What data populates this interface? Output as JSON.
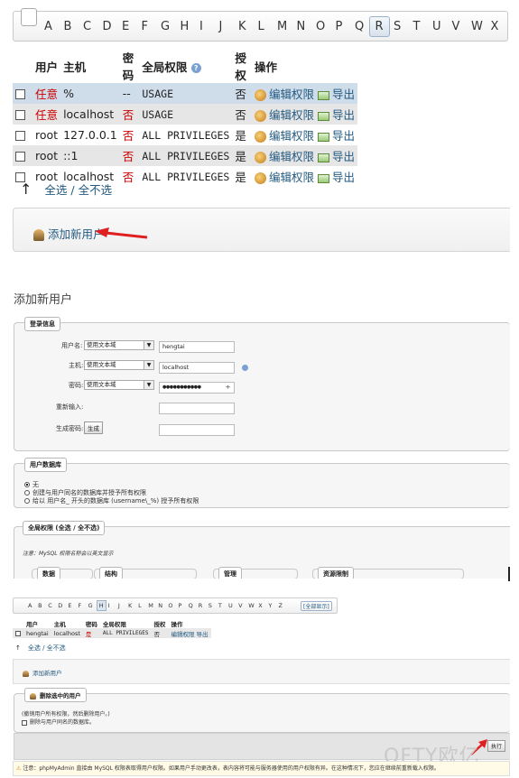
{
  "alphabet": [
    "A",
    "B",
    "C",
    "D",
    "E",
    "F",
    "G",
    "H",
    "I",
    "J",
    "K",
    "L",
    "M",
    "N",
    "O",
    "P",
    "Q",
    "R",
    "S",
    "T",
    "U",
    "V",
    "W",
    "X"
  ],
  "alphabet_active": "R",
  "table": {
    "headers": [
      "用户",
      "主机",
      "密码",
      "全局权限",
      "授权",
      "操作"
    ],
    "rows": [
      {
        "user": "任意",
        "host": "%",
        "password": "--",
        "privs": "USAGE",
        "grant": "否",
        "edit": "编辑权限",
        "export": "导出"
      },
      {
        "user": "任意",
        "host": "localhost",
        "password": "否",
        "privs": "USAGE",
        "grant": "否",
        "edit": "编辑权限",
        "export": "导出"
      },
      {
        "user": "root",
        "host": "127.0.0.1",
        "password": "否",
        "privs": "ALL PRIVILEGES",
        "grant": "是",
        "edit": "编辑权限",
        "export": "导出"
      },
      {
        "user": "root",
        "host": "::1",
        "password": "否",
        "privs": "ALL PRIVILEGES",
        "grant": "是",
        "edit": "编辑权限",
        "export": "导出"
      },
      {
        "user": "root",
        "host": "localhost",
        "password": "否",
        "privs": "ALL PRIVILEGES",
        "grant": "是",
        "edit": "编辑权限",
        "export": "导出"
      }
    ]
  },
  "select_all": "全选 / 全不选",
  "add_user": "添加新用户",
  "add_user_heading": "添加新用户",
  "login_info": {
    "legend": "登录信息",
    "username_label": "用户名:",
    "username_mode": "使用文本域",
    "username_value": "hengtai",
    "host_label": "主机:",
    "host_mode": "使用文本域",
    "host_value": "localhost",
    "password_label": "密码:",
    "password_mode": "使用文本域",
    "password_value": "●●●●●●●●●●●",
    "reenter_label": "重新输入:",
    "generate_label": "生成密码:",
    "generate_button": "生成"
  },
  "user_db": {
    "legend": "用户数据库",
    "opt_none": "无",
    "opt_create": "创建与用户同名的数据库并授予所有权限",
    "opt_wildcard": "给以 用户名_ 开头的数据库 (username\\_%) 授予所有权限"
  },
  "global_privs": {
    "legend": "全局权限 (全选 / 全不选)",
    "note": "注意：MySQL 权限名称会以英文显示",
    "groups": [
      "数据",
      "结构",
      "管理",
      "资源限制"
    ]
  },
  "mini": {
    "letters": [
      "A",
      "B",
      "C",
      "D",
      "E",
      "F",
      "G",
      "H",
      "I",
      "J",
      "K",
      "L",
      "M",
      "N",
      "O",
      "P",
      "Q",
      "R",
      "S",
      "T",
      "U",
      "V",
      "W",
      "X",
      "Y",
      "Z"
    ],
    "active": "H",
    "show_all": "[全部显示]",
    "headers": [
      "用户",
      "主机",
      "密码",
      "全局权限",
      "授权",
      "操作"
    ],
    "row": {
      "user": "hengtai",
      "host": "localhost",
      "password": "是",
      "privs": "ALL PRIVILEGES",
      "grant": "否",
      "edit": "编辑权限",
      "export": "导出"
    },
    "select_all": "全选 / 全不选",
    "add_user": "添加新用户",
    "delete_legend": "删除选中的用户",
    "delete_note": "(撤销用户所有权限，然后删除用户。)",
    "delete_db_opt": "删除与用户同名的数据库。",
    "go_button": "执行"
  },
  "watermark": "OFTY欧亿",
  "notice": "注意：phpMyAdmin 直接由 MySQL 权限表取得用户权限。如果用户手动更改表，表内容将可能与服务器使用的用户权限有异。在这种情况下，您应在继续前重新载入权限。"
}
